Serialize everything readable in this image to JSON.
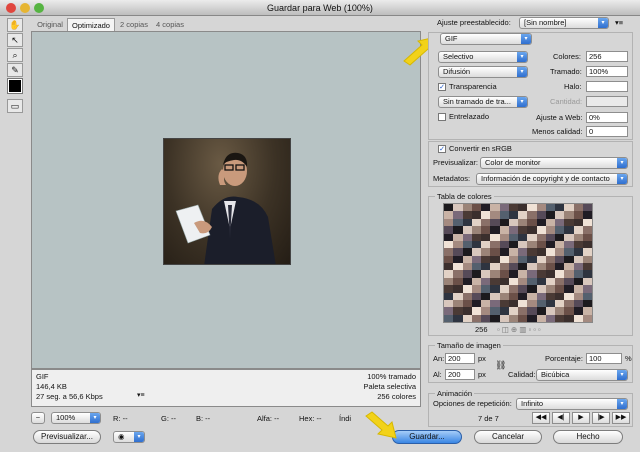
{
  "window": {
    "title": "Guardar para Web (100%)"
  },
  "tabs": [
    "Original",
    "Optimizado",
    "2 copias",
    "4 copias"
  ],
  "image_info": {
    "left": [
      "GIF",
      "146,4 KB",
      "27 seg. a 56,6 Kbps"
    ],
    "right": [
      "100% tramado",
      "Paleta selectiva",
      "256 colores"
    ]
  },
  "statusbar": {
    "zoom": "100%",
    "r": "R: --",
    "g": "G: --",
    "b": "B: --",
    "alpha": "Alfa: --",
    "hex": "Hex: --",
    "index": "Índi"
  },
  "settings": {
    "preset_label": "Ajuste preestablecido:",
    "preset_value": "[Sin nombre]",
    "format": "GIF",
    "reduction": "Selectivo",
    "colors_label": "Colores:",
    "colors_value": "256",
    "dither_algo": "Difusión",
    "dither_label": "Tramado:",
    "dither_value": "100%",
    "transparency_label": "Transparencia",
    "matte_label": "Halo:",
    "trans_dither": "Sin tramado de tra...",
    "amount_label": "Cantidad:",
    "interlaced_label": "Entrelazado",
    "websnap_label": "Ajuste a Web:",
    "websnap_value": "0%",
    "lossy_label": "Menos calidad:",
    "lossy_value": "0",
    "convert_srgb": "Convertir en sRGB",
    "preview_label": "Previsualizar:",
    "preview_value": "Color de monitor",
    "metadata_label": "Metadatos:",
    "metadata_value": "Información de copyright y de contacto"
  },
  "color_table": {
    "title": "Tabla de colores",
    "count": "256",
    "colors": [
      "#1c1a1e",
      "#4a3a35",
      "#8a7068",
      "#c9b3a6",
      "#2e3440",
      "#6b5048",
      "#a48a80",
      "#d8c7bd",
      "#3b2f2d",
      "#564a58",
      "#7a6a7a",
      "#e2d2c6",
      "#201c24",
      "#54606e",
      "#9b8478",
      "#f0e2d6"
    ]
  },
  "image_size": {
    "title": "Tamaño de imagen",
    "width_label": "An:",
    "width_value": "200",
    "width_unit": "px",
    "height_label": "Al:",
    "height_value": "200",
    "height_unit": "px",
    "percent_label": "Porcentaje:",
    "percent_value": "100",
    "percent_unit": "%",
    "quality_label": "Calidad:",
    "quality_value": "Bicúbica"
  },
  "animation": {
    "title": "Animación",
    "loop_label": "Opciones de repetición:",
    "loop_value": "Infinito",
    "frame_counter": "7 de 7"
  },
  "buttons": {
    "preview": "Previsualizar...",
    "save": "Guardar...",
    "cancel": "Cancelar",
    "done": "Hecho"
  },
  "colors": {
    "accent": "#3a86e4",
    "canvas": "#b7c3c4",
    "highlight_arrow": "#f2d21a"
  }
}
